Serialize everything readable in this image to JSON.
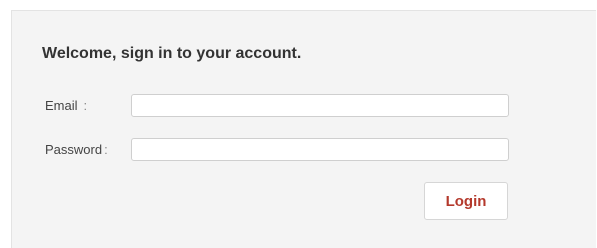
{
  "login_form": {
    "title": "Welcome, sign in to your account.",
    "email_label": "Email",
    "email_colon": ":",
    "email_value": "",
    "email_placeholder": "",
    "password_label": "Password",
    "password_colon": ":",
    "password_value": "",
    "password_placeholder": "",
    "login_label": "Login"
  },
  "colors": {
    "panel_background": "#f4f4f4",
    "login_text": "#b4392c"
  }
}
